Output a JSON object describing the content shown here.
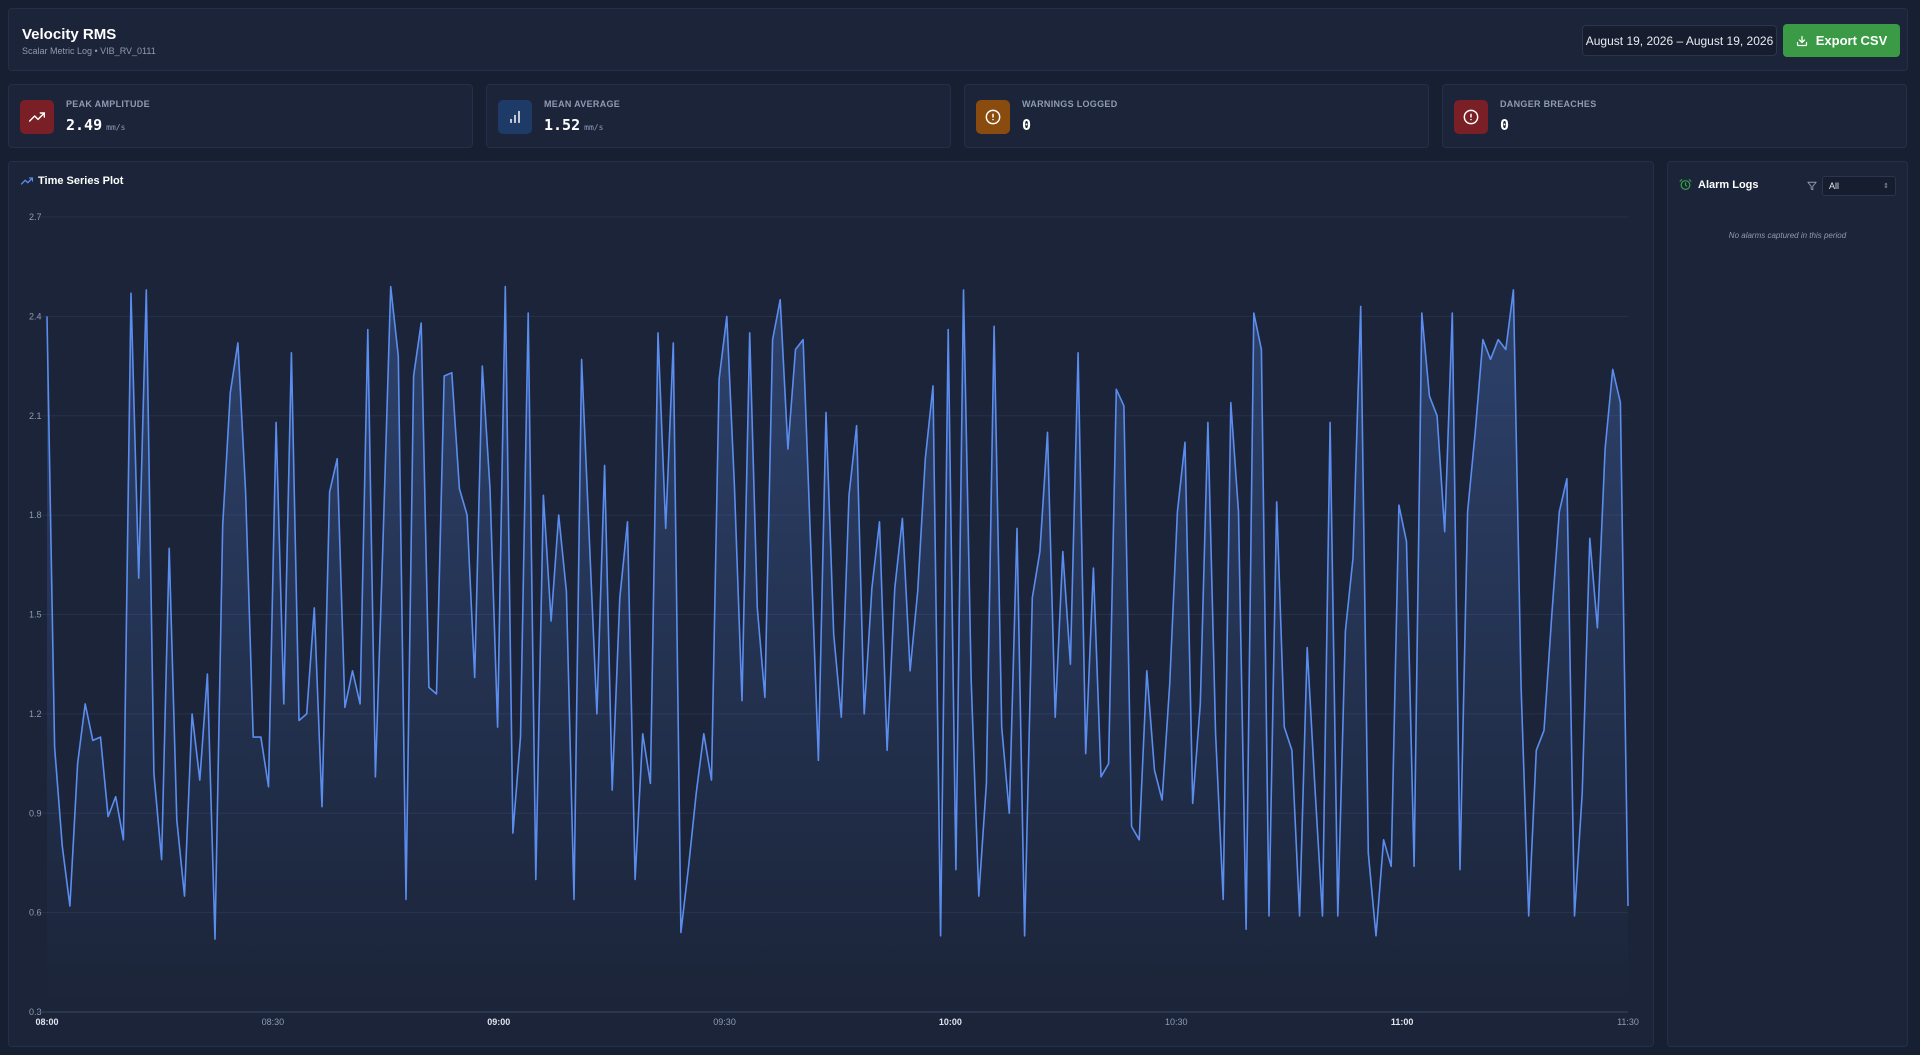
{
  "header": {
    "title": "Velocity RMS",
    "subtitle": "Scalar Metric Log • VIB_RV_0111",
    "date_range": "August 19, 2026 – August 19, 2026",
    "export_label": "Export CSV"
  },
  "stats": [
    {
      "label": "PEAK AMPLITUDE",
      "value": "2.49",
      "unit": "mm/s",
      "icon": "trending-up-icon",
      "color": "#7a1f25"
    },
    {
      "label": "MEAN AVERAGE",
      "value": "1.52",
      "unit": "mm/s",
      "icon": "bar-chart-icon",
      "color": "#1e3a66"
    },
    {
      "label": "WARNINGS LOGGED",
      "value": "0",
      "unit": "",
      "icon": "alert-circle-icon",
      "color": "#8a4b0f"
    },
    {
      "label": "DANGER BREACHES",
      "value": "0",
      "unit": "",
      "icon": "alert-circle-icon",
      "color": "#7a1f25"
    }
  ],
  "chart_panel": {
    "title": "Time Series Plot"
  },
  "alarm_panel": {
    "title": "Alarm Logs",
    "filter_value": "All",
    "empty_text": "No alarms captured in this period"
  },
  "chart_data": {
    "type": "area",
    "series_color": "#5b8def",
    "ylim": [
      0.3,
      2.7
    ],
    "yticks": [
      "0.3",
      "0.6",
      "0.9",
      "1.2",
      "1.5",
      "1.8",
      "2.1",
      "2.4",
      "2.7"
    ],
    "xlim": [
      "08:00",
      "11:30"
    ],
    "xticks": [
      {
        "label": "08:00",
        "t": "08:00",
        "major": true
      },
      {
        "label": "08:30",
        "t": "08:30",
        "major": false
      },
      {
        "label": "09:00",
        "t": "09:00",
        "major": true
      },
      {
        "label": "09:30",
        "t": "09:30",
        "major": false
      },
      {
        "label": "10:00",
        "t": "10:00",
        "major": true
      },
      {
        "label": "10:30",
        "t": "10:30",
        "major": false
      },
      {
        "label": "11:00",
        "t": "11:00",
        "major": true
      },
      {
        "label": "11:30",
        "t": "11:30",
        "major": false
      }
    ],
    "values": [
      2.4,
      1.1,
      0.8,
      0.62,
      1.05,
      1.23,
      1.12,
      1.13,
      0.89,
      0.95,
      0.82,
      2.47,
      1.61,
      2.48,
      1.02,
      0.76,
      1.7,
      0.88,
      0.65,
      1.2,
      1.0,
      1.32,
      0.52,
      1.77,
      2.17,
      2.32,
      1.87,
      1.13,
      1.13,
      0.98,
      2.08,
      1.23,
      2.29,
      1.18,
      1.2,
      1.52,
      0.92,
      1.87,
      1.97,
      1.22,
      1.33,
      1.23,
      2.36,
      1.01,
      1.73,
      2.49,
      2.28,
      0.64,
      2.22,
      2.38,
      1.28,
      1.26,
      2.22,
      2.23,
      1.88,
      1.8,
      1.31,
      2.25,
      1.88,
      1.16,
      2.49,
      0.84,
      1.13,
      2.41,
      0.7,
      1.86,
      1.48,
      1.8,
      1.57,
      0.64,
      2.27,
      1.73,
      1.2,
      1.95,
      0.97,
      1.55,
      1.78,
      0.7,
      1.14,
      0.99,
      2.35,
      1.76,
      2.32,
      0.54,
      0.74,
      0.96,
      1.14,
      1.0,
      2.21,
      2.4,
      1.89,
      1.24,
      2.35,
      1.52,
      1.25,
      2.33,
      2.45,
      2.0,
      2.3,
      2.33,
      1.7,
      1.06,
      2.11,
      1.44,
      1.19,
      1.86,
      2.07,
      1.2,
      1.58,
      1.78,
      1.09,
      1.58,
      1.79,
      1.33,
      1.57,
      1.97,
      2.19,
      0.53,
      2.36,
      0.73,
      2.48,
      1.3,
      0.65,
      0.99,
      2.37,
      1.16,
      0.9,
      1.76,
      0.53,
      1.55,
      1.69,
      2.05,
      1.19,
      1.69,
      1.35,
      2.29,
      1.08,
      1.64,
      1.01,
      1.05,
      2.18,
      2.13,
      0.86,
      0.82,
      1.33,
      1.03,
      0.94,
      1.29,
      1.81,
      2.02,
      0.93,
      1.23,
      2.08,
      1.14,
      0.64,
      2.14,
      1.81,
      0.55,
      2.41,
      2.3,
      0.59,
      1.84,
      1.16,
      1.09,
      0.59,
      1.4,
      0.98,
      0.59,
      2.08,
      0.59,
      1.45,
      1.67,
      2.43,
      0.78,
      0.53,
      0.82,
      0.74,
      1.83,
      1.72,
      0.74,
      2.41,
      2.16,
      2.1,
      1.75,
      2.41,
      0.73,
      1.81,
      2.05,
      2.33,
      2.27,
      2.33,
      2.3,
      2.48,
      1.28,
      0.59,
      1.09,
      1.15,
      1.49,
      1.81,
      1.91,
      0.59,
      0.96,
      1.73,
      1.46,
      2.0,
      2.24,
      2.14,
      0.62
    ]
  }
}
